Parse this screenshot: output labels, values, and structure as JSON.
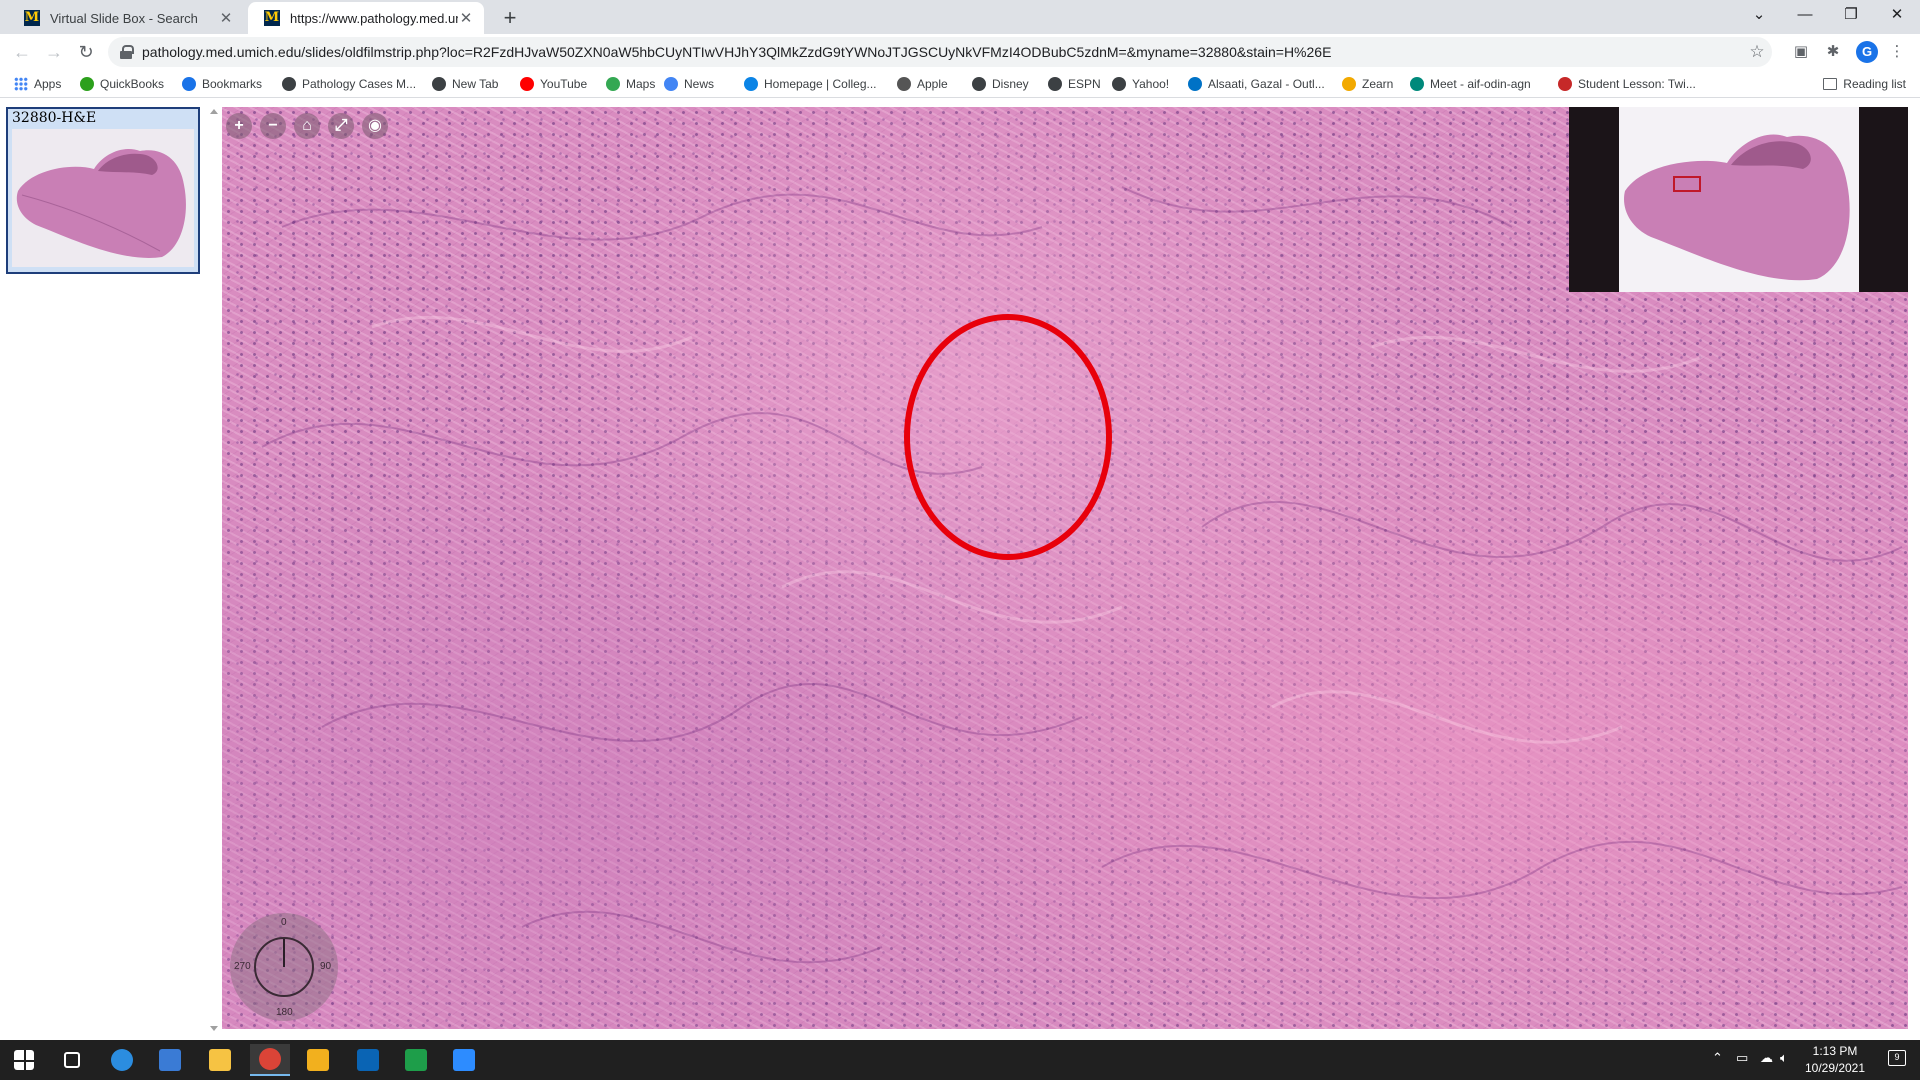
{
  "browser": {
    "tabs": [
      {
        "title": "Virtual Slide Box - Search",
        "favicon": "M"
      },
      {
        "title": "https://www.pathology.med.umi",
        "favicon": "M"
      }
    ],
    "new_tab_glyph": "+",
    "window_controls": {
      "tab_search": "⌄",
      "minimize": "—",
      "restore": "❐",
      "close": "✕"
    },
    "url": "pathology.med.umich.edu/slides/oldfilmstrip.php?loc=R2FzdHJvaW50ZXN0aW5hbCUyNTIwVHJhY3QlMkZzdG9tYWNoJTJGSCUyNkVFMzI4ODBubC5zdnM=&myname=32880&stain=H%26E",
    "profile_initial": "G",
    "bookmarks": [
      {
        "label": "Apps",
        "color": "#4285f4"
      },
      {
        "label": "QuickBooks",
        "color": "#2ca01c"
      },
      {
        "label": "Bookmarks",
        "color": "#1a73e8"
      },
      {
        "label": "Pathology Cases M...",
        "color": "#3c4043"
      },
      {
        "label": "New Tab",
        "color": "#3c4043"
      },
      {
        "label": "YouTube",
        "color": "#ff0000"
      },
      {
        "label": "Maps",
        "color": "#34a853"
      },
      {
        "label": "News",
        "color": "#4285f4"
      },
      {
        "label": "Homepage | Colleg...",
        "color": "#0b84e6"
      },
      {
        "label": "Apple",
        "color": "#555555"
      },
      {
        "label": "Disney",
        "color": "#3c4043"
      },
      {
        "label": "ESPN",
        "color": "#3c4043"
      },
      {
        "label": "Yahoo!",
        "color": "#3c4043"
      },
      {
        "label": "Alsaati, Gazal - Outl...",
        "color": "#0072c6"
      },
      {
        "label": "Zearn",
        "color": "#f2a900"
      },
      {
        "label": "Meet - aif-odin-agn",
        "color": "#00897b"
      },
      {
        "label": "Student Lesson: Twi...",
        "color": "#c62828"
      }
    ],
    "reading_list": "Reading list"
  },
  "slide": {
    "thumbnail_label": "32880-H&E",
    "viewer_controls": [
      "+",
      "−",
      "⌂",
      "⤢",
      "◉"
    ],
    "compass": {
      "top": "0",
      "right": "90",
      "bottom": "180",
      "left": "270"
    }
  },
  "taskbar": {
    "time": "1:13 PM",
    "date": "10/29/2021",
    "notifications": "9",
    "apps": [
      {
        "name": "start",
        "color": "#ffffff"
      },
      {
        "name": "task-view",
        "color": "#ffffff"
      },
      {
        "name": "edge",
        "color": "#2b8de0"
      },
      {
        "name": "store",
        "color": "#3a7bd5"
      },
      {
        "name": "file-explorer",
        "color": "#f6c343"
      },
      {
        "name": "chrome",
        "color": "#db4437"
      },
      {
        "name": "app-yellow",
        "color": "#f2b01e"
      },
      {
        "name": "outlook",
        "color": "#0a64b4"
      },
      {
        "name": "app-green",
        "color": "#1e9e4a"
      },
      {
        "name": "zoom",
        "color": "#2d8cff"
      }
    ]
  }
}
